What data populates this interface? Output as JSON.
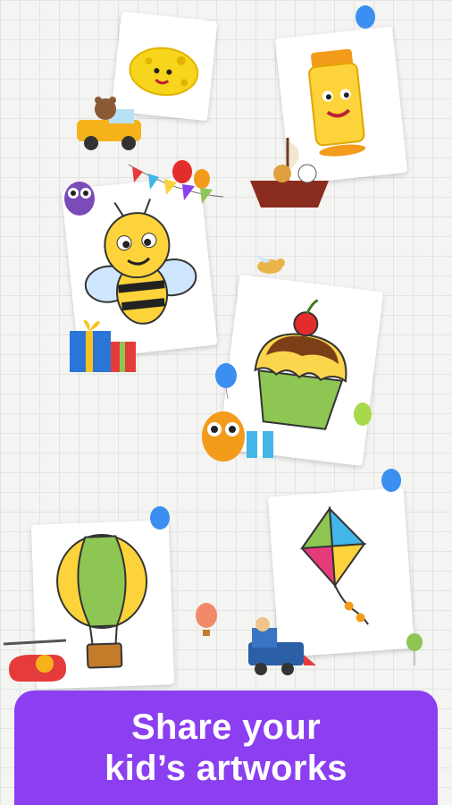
{
  "banner": {
    "line1": "Share your",
    "line2": "kid’s artworks"
  },
  "colors": {
    "banner": "#8b3ff0",
    "background": "#f4f4f2",
    "grid": "#e3e3e1"
  },
  "artworks": [
    "cheese",
    "glue-bottle",
    "bee",
    "cupcake",
    "hot-air-balloon",
    "kite"
  ],
  "stickers": [
    "bear-truck",
    "ship-with-animals",
    "owl-purple",
    "bunting",
    "gift-boxes",
    "bird",
    "owl-orange",
    "balloons",
    "helicopter",
    "train"
  ]
}
